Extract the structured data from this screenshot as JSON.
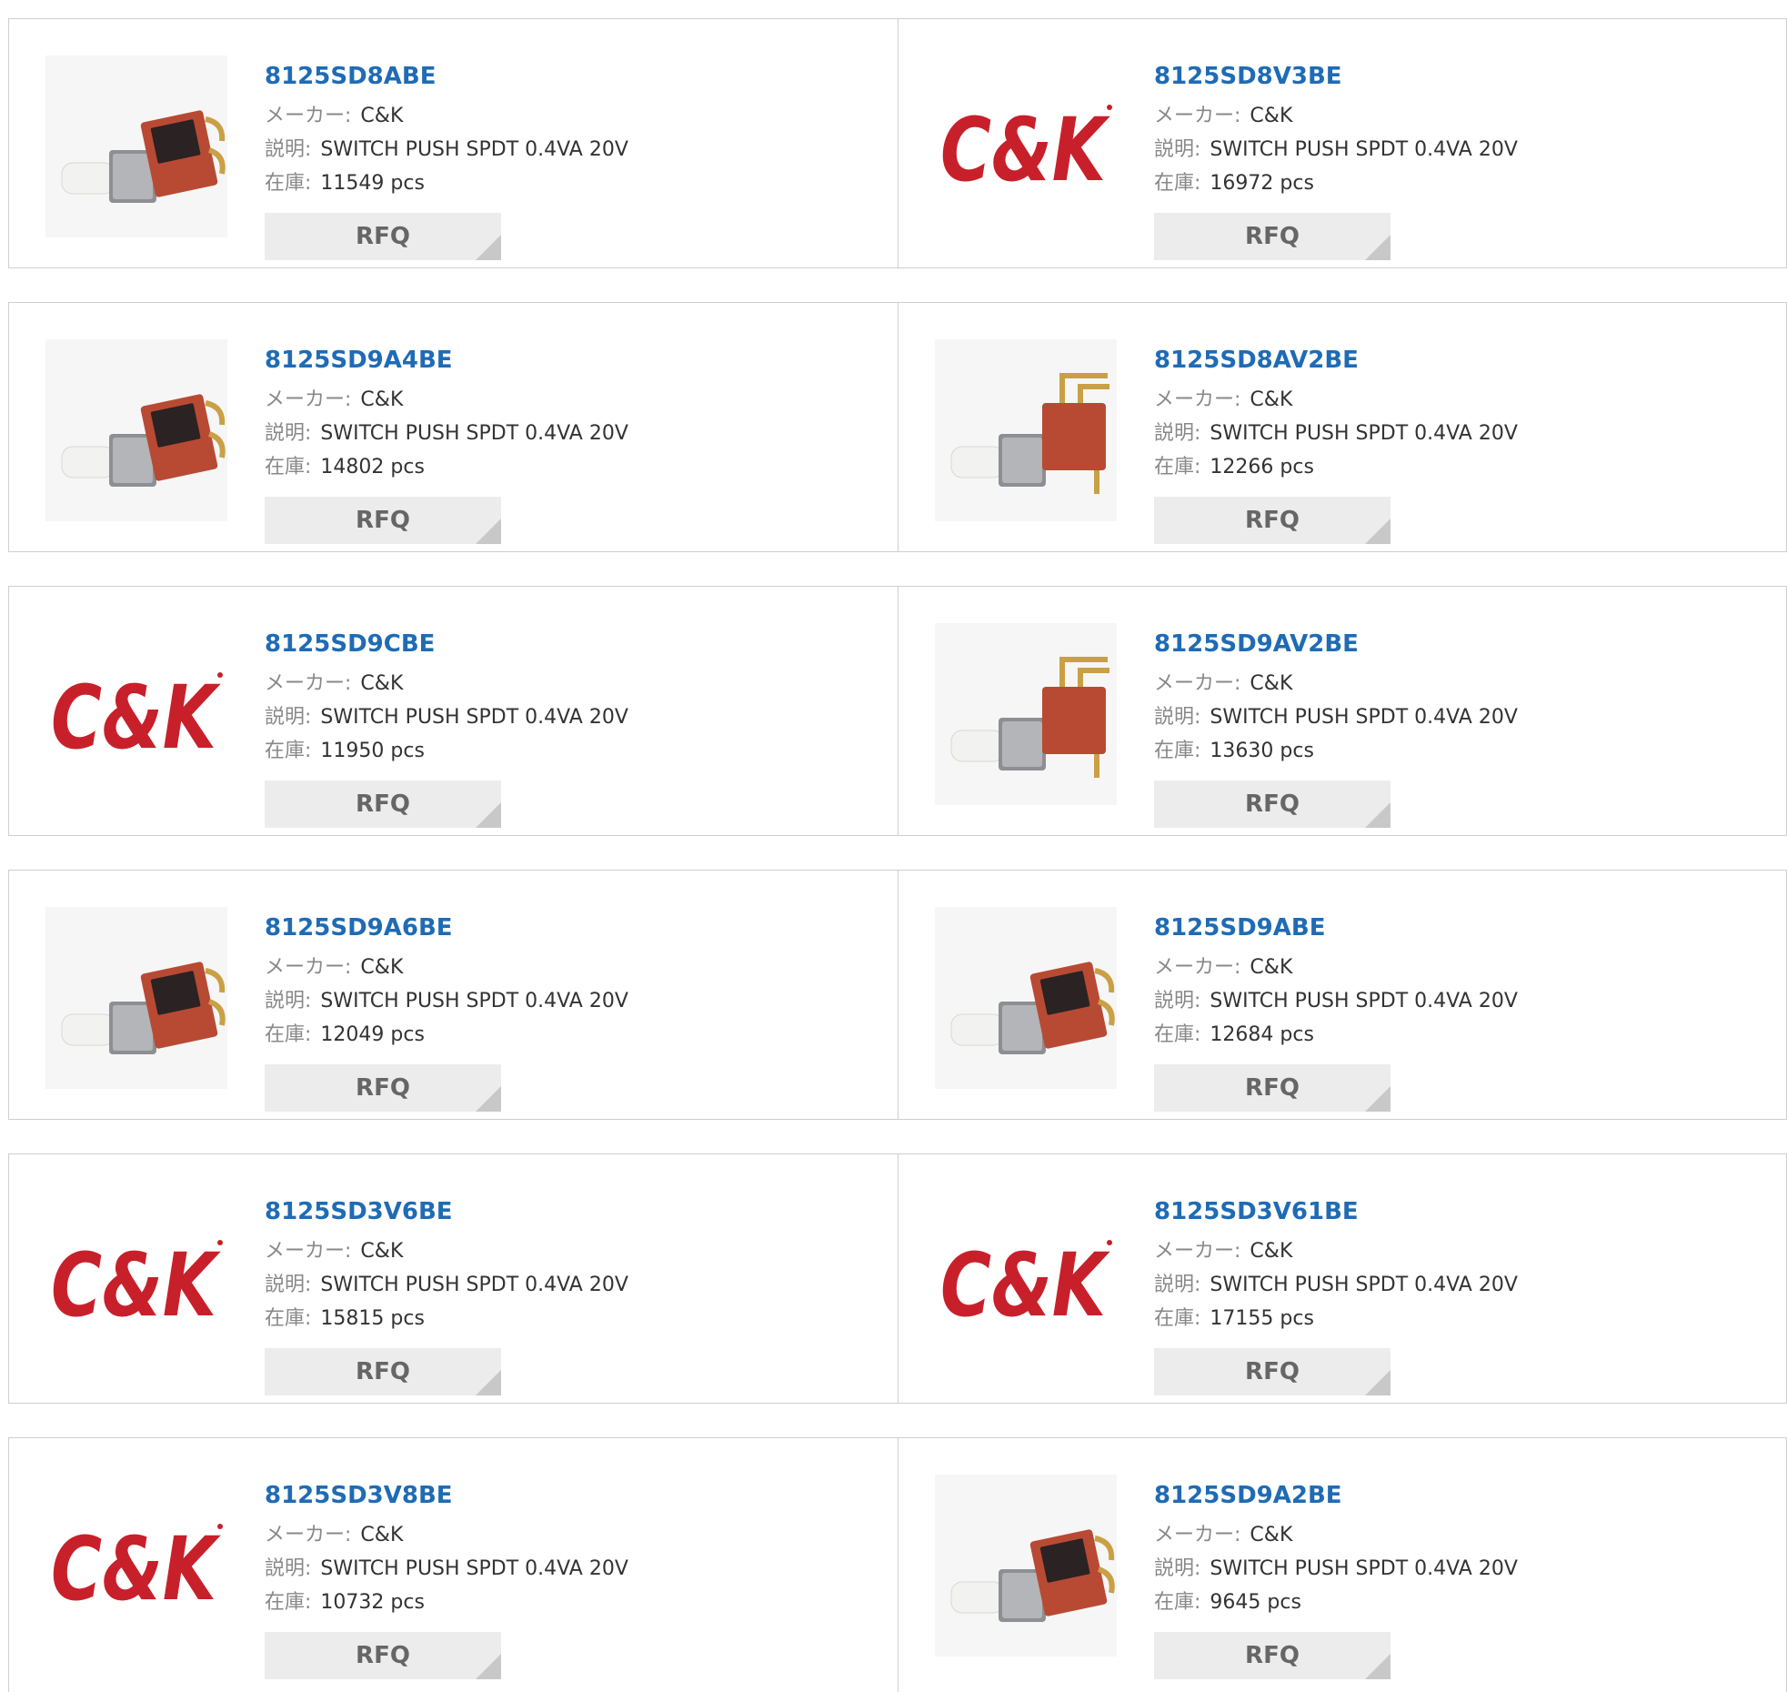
{
  "labels": {
    "manufacturer": "メーカー:",
    "description": "説明:",
    "stock": "在庫:",
    "rfq": "RFQ"
  },
  "logo_text": "C&K",
  "colors": {
    "part_link": "#1f6bb5",
    "logo_red": "#c8202a",
    "switch_body": "#b84a34"
  },
  "products": [
    {
      "part": "8125SD8ABE",
      "manufacturer": "C&K",
      "description": "SWITCH PUSH SPDT 0.4VA 20V",
      "stock": "11549 pcs",
      "image": "switch-photo"
    },
    {
      "part": "8125SD8V3BE",
      "manufacturer": "C&K",
      "description": "SWITCH PUSH SPDT 0.4VA 20V",
      "stock": "16972 pcs",
      "image": "ck-logo"
    },
    {
      "part": "8125SD9A4BE",
      "manufacturer": "C&K",
      "description": "SWITCH PUSH SPDT 0.4VA 20V",
      "stock": "14802 pcs",
      "image": "switch-photo"
    },
    {
      "part": "8125SD8AV2BE",
      "manufacturer": "C&K",
      "description": "SWITCH PUSH SPDT 0.4VA 20V",
      "stock": "12266 pcs",
      "image": "switch-photo-side"
    },
    {
      "part": "8125SD9CBE",
      "manufacturer": "C&K",
      "description": "SWITCH PUSH SPDT 0.4VA 20V",
      "stock": "11950 pcs",
      "image": "ck-logo"
    },
    {
      "part": "8125SD9AV2BE",
      "manufacturer": "C&K",
      "description": "SWITCH PUSH SPDT 0.4VA 20V",
      "stock": "13630 pcs",
      "image": "switch-photo-side"
    },
    {
      "part": "8125SD9A6BE",
      "manufacturer": "C&K",
      "description": "SWITCH PUSH SPDT 0.4VA 20V",
      "stock": "12049 pcs",
      "image": "switch-photo"
    },
    {
      "part": "8125SD9ABE",
      "manufacturer": "C&K",
      "description": "SWITCH PUSH SPDT 0.4VA 20V",
      "stock": "12684 pcs",
      "image": "switch-photo"
    },
    {
      "part": "8125SD3V6BE",
      "manufacturer": "C&K",
      "description": "SWITCH PUSH SPDT 0.4VA 20V",
      "stock": "15815 pcs",
      "image": "ck-logo"
    },
    {
      "part": "8125SD3V61BE",
      "manufacturer": "C&K",
      "description": "SWITCH PUSH SPDT 0.4VA 20V",
      "stock": "17155 pcs",
      "image": "ck-logo"
    },
    {
      "part": "8125SD3V8BE",
      "manufacturer": "C&K",
      "description": "SWITCH PUSH SPDT 0.4VA 20V",
      "stock": "10732 pcs",
      "image": "ck-logo"
    },
    {
      "part": "8125SD9A2BE",
      "manufacturer": "C&K",
      "description": "SWITCH PUSH SPDT 0.4VA 20V",
      "stock": "9645 pcs",
      "image": "switch-photo"
    }
  ]
}
